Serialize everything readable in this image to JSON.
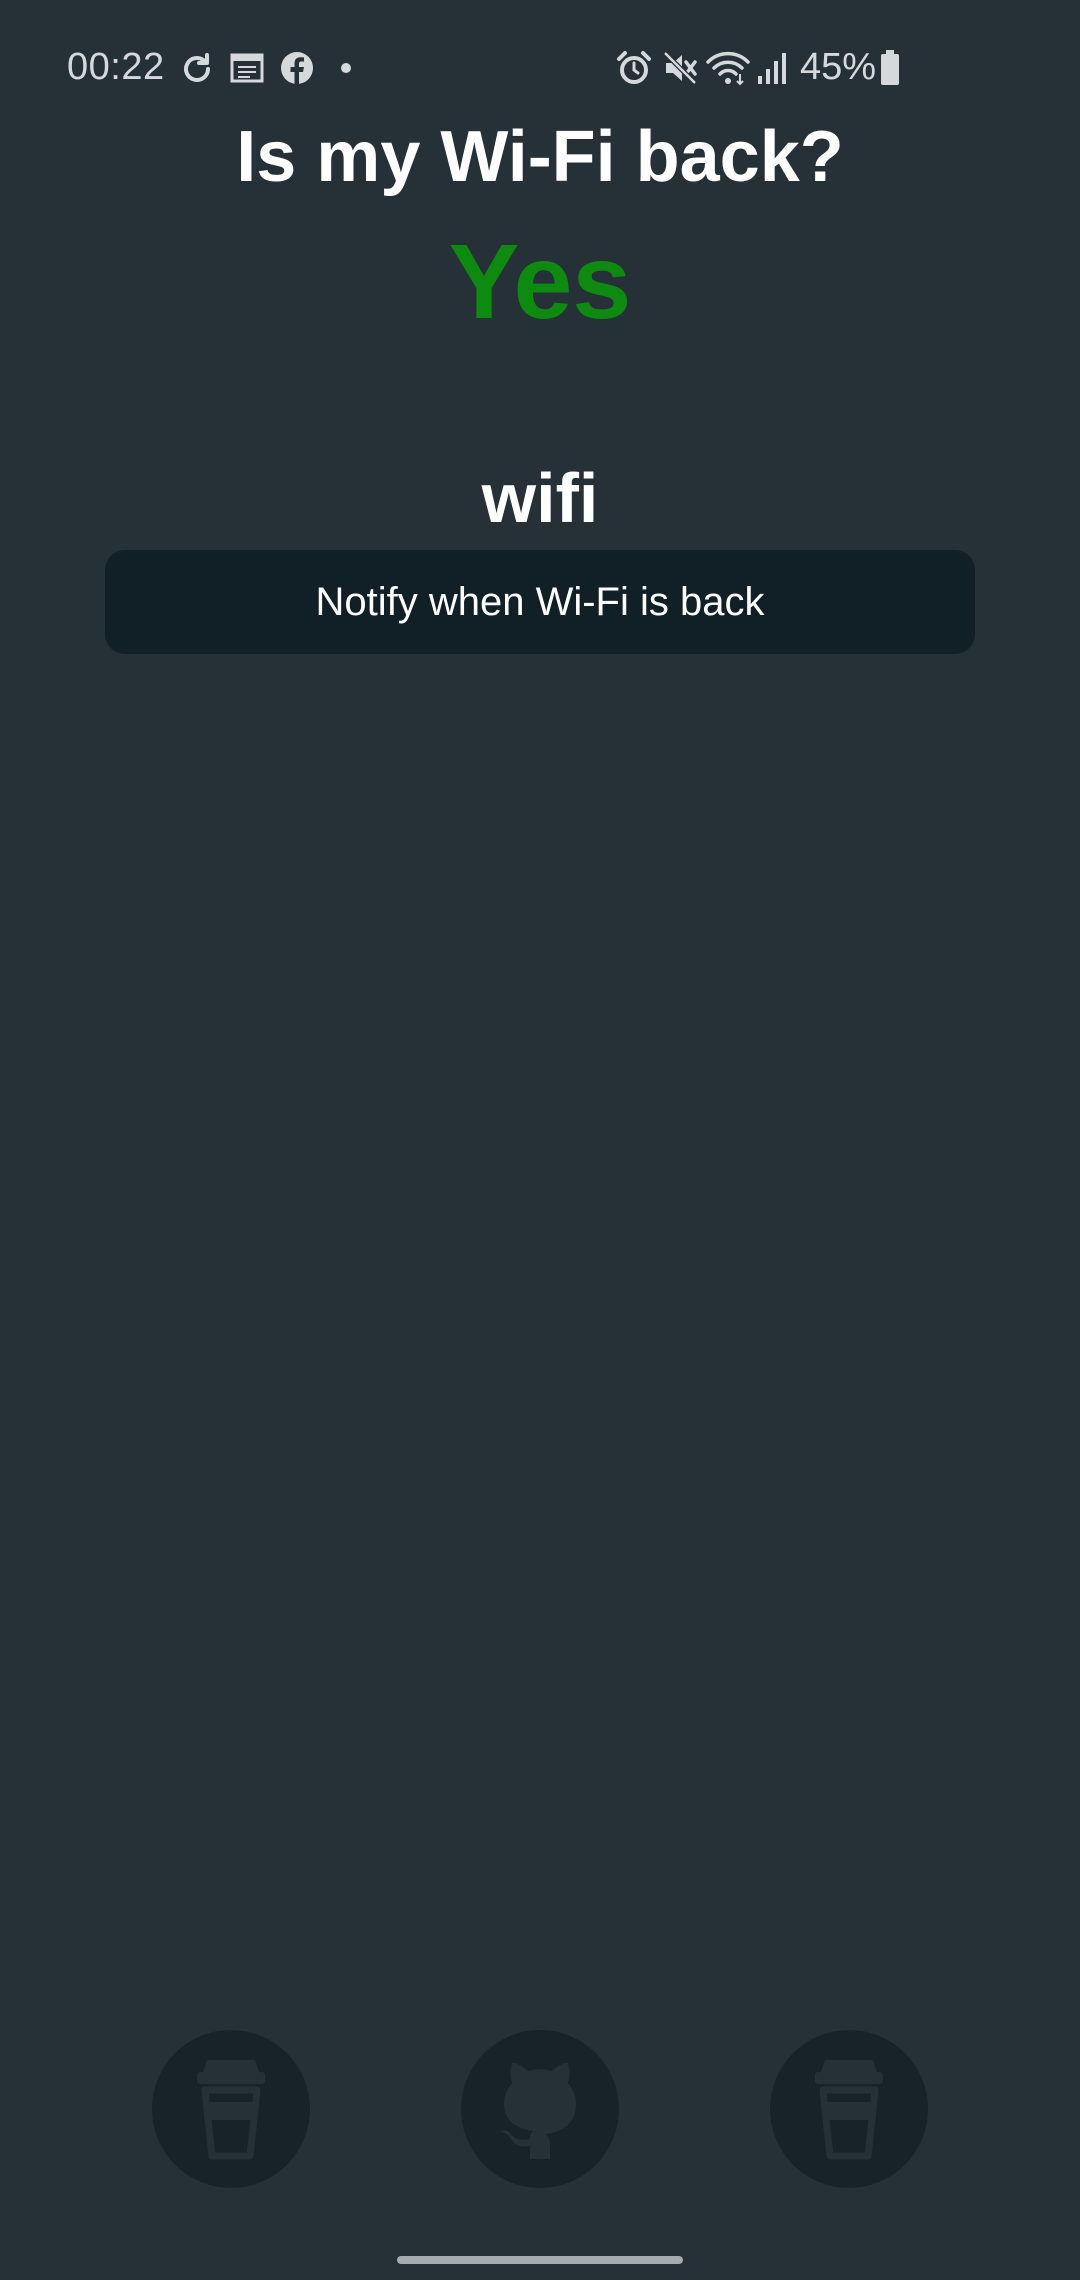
{
  "status_bar": {
    "time": "00:22",
    "battery": "45%",
    "left_icons": [
      "sync-icon",
      "calendar-icon",
      "facebook-icon",
      "dot-icon"
    ],
    "right_icons": [
      "alarm-icon",
      "mute-icon",
      "wifi-icon",
      "signal-icon",
      "battery-icon"
    ]
  },
  "main": {
    "headline": "Is my Wi-Fi back?",
    "answer": "Yes",
    "answer_color": "#0f8a10",
    "network_name": "wifi",
    "notify_label": "Notify when Wi-Fi is back"
  },
  "footer": {
    "buttons": [
      {
        "icon": "coffee-cup-icon"
      },
      {
        "icon": "github-icon"
      },
      {
        "icon": "coffee-cup-icon"
      }
    ]
  },
  "colors": {
    "background": "#263037",
    "button_bg": "#111f27",
    "round_button_bg": "#172229"
  }
}
